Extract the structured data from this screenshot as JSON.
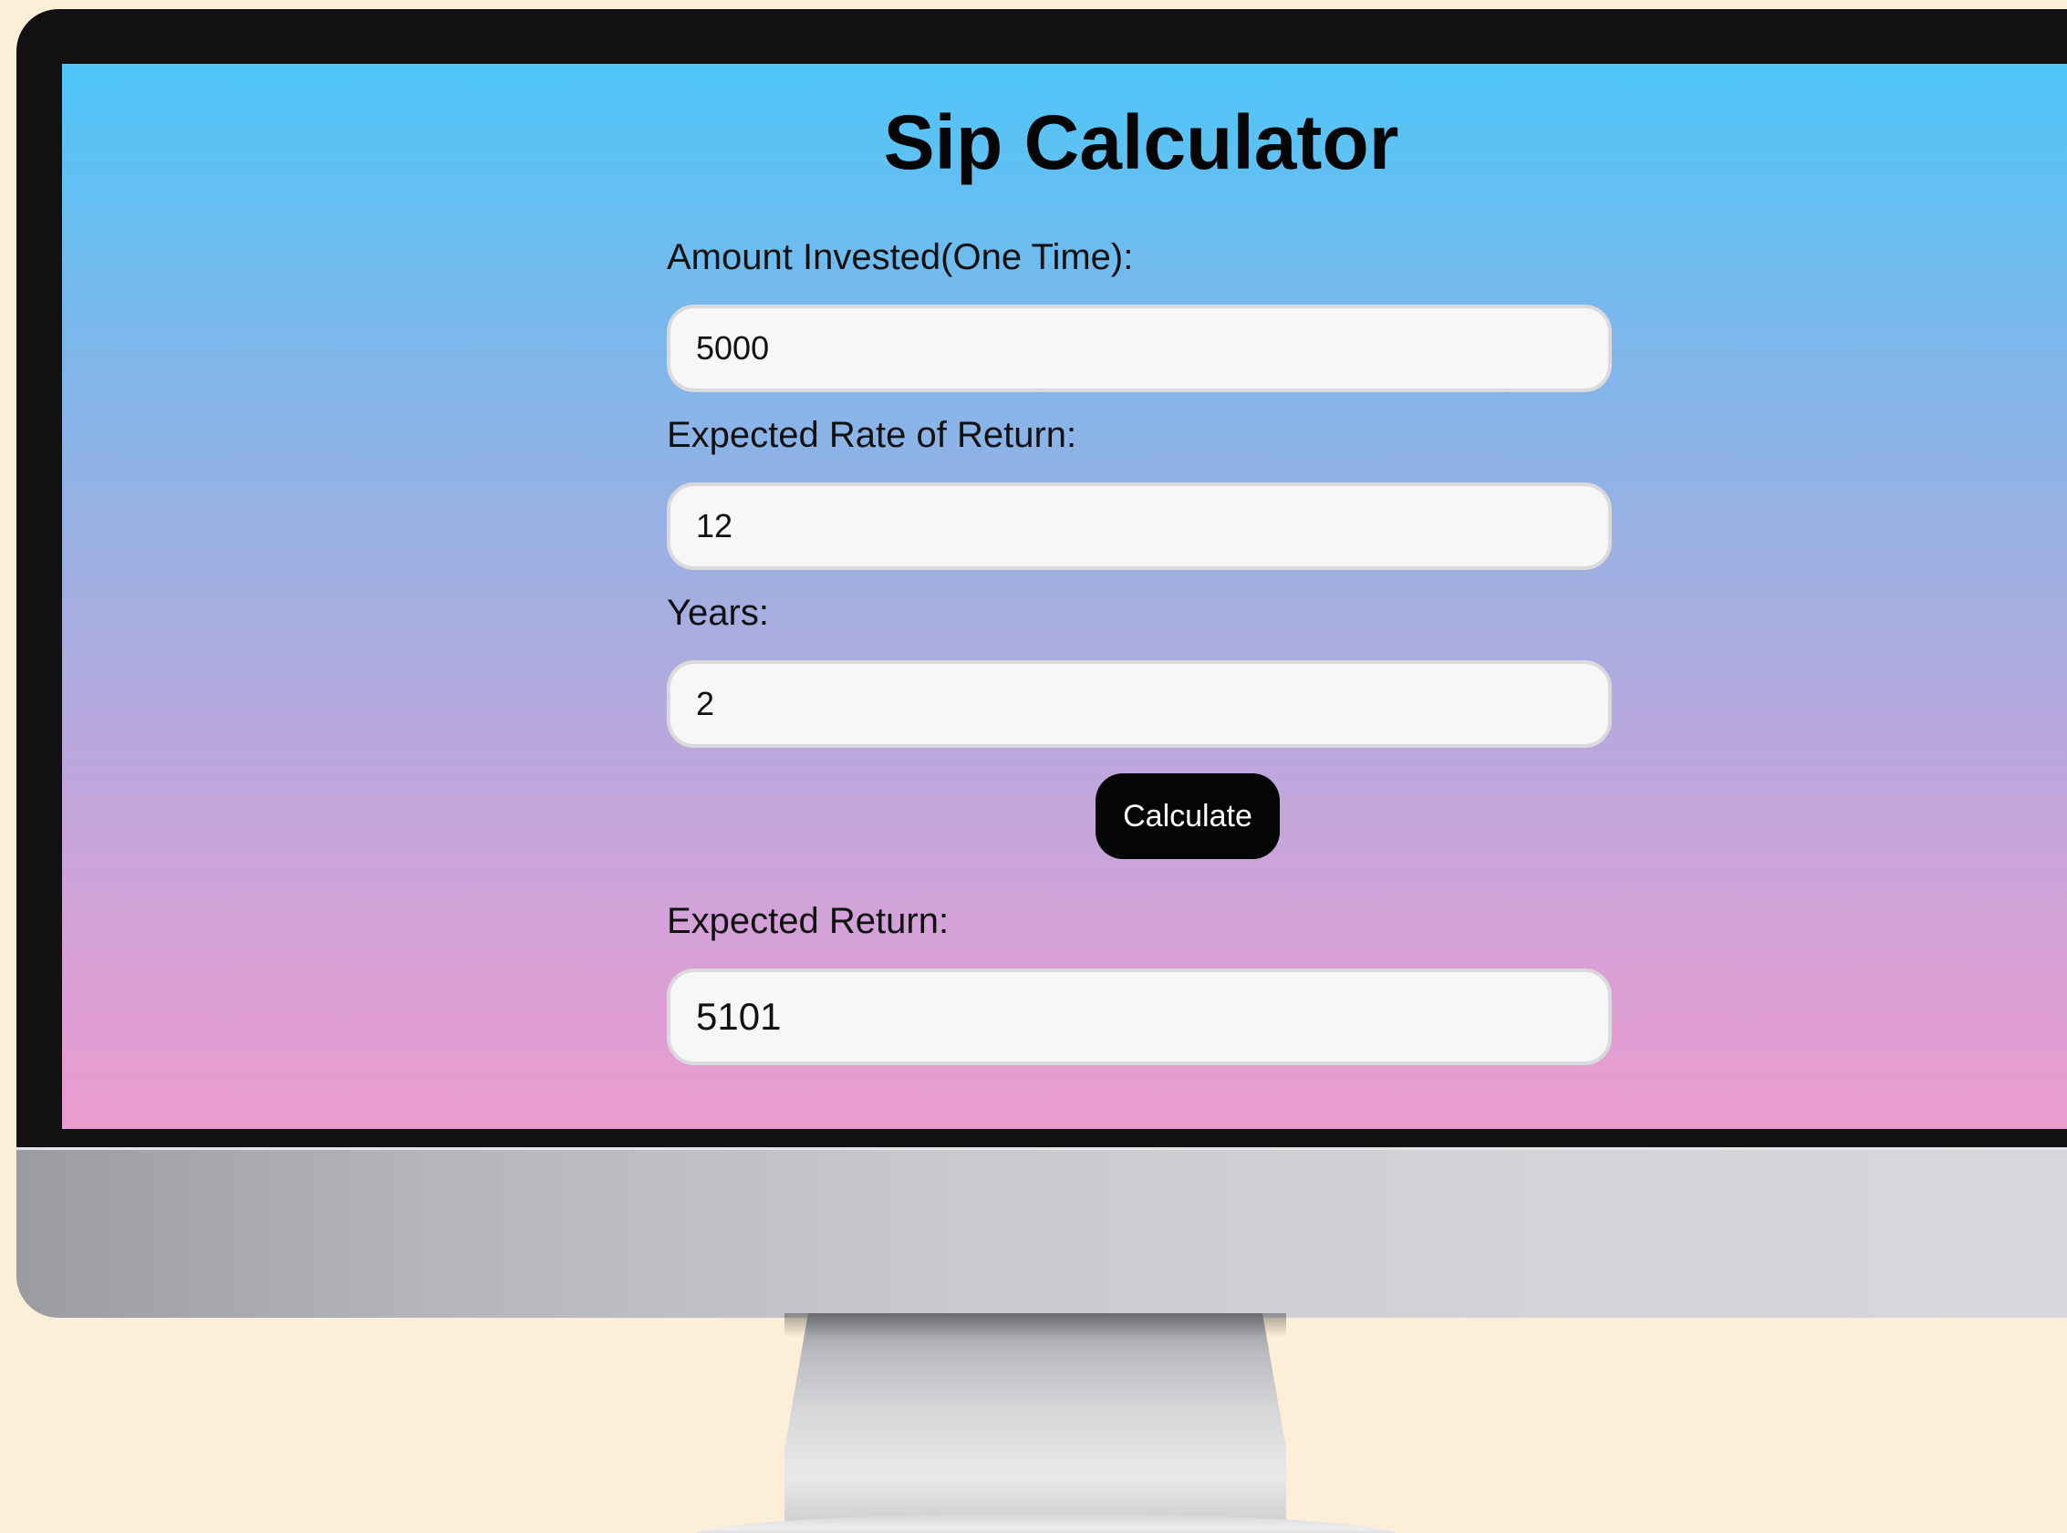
{
  "app": {
    "title": "Sip Calculator"
  },
  "form": {
    "amount": {
      "label": "Amount Invested(One Time):",
      "value": "5000"
    },
    "rate": {
      "label": "Expected Rate of Return:",
      "value": "12"
    },
    "years": {
      "label": "Years:",
      "value": "2"
    },
    "calculate_label": "Calculate",
    "result": {
      "label": "Expected Return:",
      "value": "5101"
    }
  },
  "colors": {
    "page_background": "#fdeed8",
    "screen_gradient_top": "#4fc6f8",
    "screen_gradient_bottom": "#eb9ccf",
    "button_background": "#050505",
    "input_background": "#f7f7f7"
  }
}
